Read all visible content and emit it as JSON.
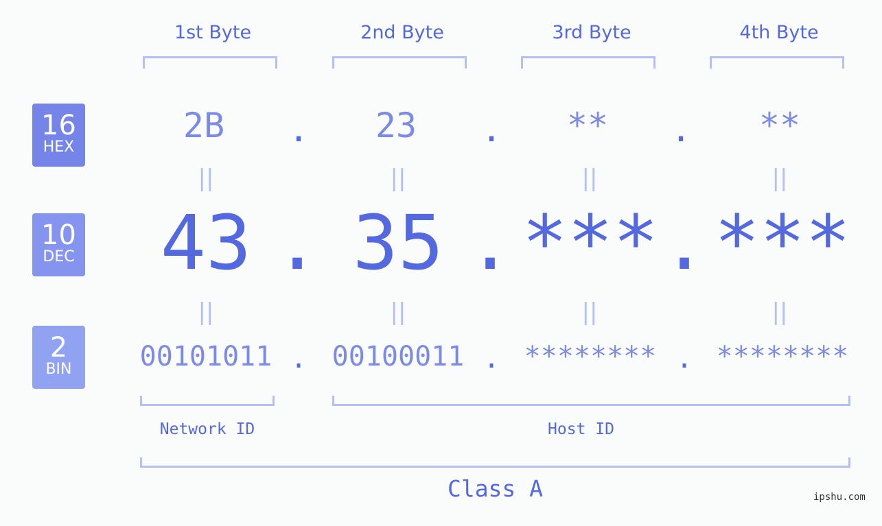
{
  "bytes": [
    {
      "label": "1st Byte",
      "hex": "2B",
      "dec": "43",
      "bin": "00101011"
    },
    {
      "label": "2nd Byte",
      "hex": "23",
      "dec": "35",
      "bin": "00100011"
    },
    {
      "label": "3rd Byte",
      "hex": "**",
      "dec": "***",
      "bin": "********"
    },
    {
      "label": "4th Byte",
      "hex": "**",
      "dec": "***",
      "bin": "********"
    }
  ],
  "separator": ".",
  "equals": "||",
  "badges": {
    "hex": {
      "num": "16",
      "unit": "HEX",
      "color": "#7484e9"
    },
    "dec": {
      "num": "10",
      "unit": "DEC",
      "color": "#8594ee"
    },
    "bin": {
      "num": "2",
      "unit": "BIN",
      "color": "#91a2f3"
    }
  },
  "network_id_label": "Network ID",
  "host_id_label": "Host ID",
  "class_label": "Class A",
  "watermark": "ipshu.com",
  "colors": {
    "primary": "#5468e0",
    "light": "#7c8ae7",
    "bracket": "#b4bff3"
  }
}
